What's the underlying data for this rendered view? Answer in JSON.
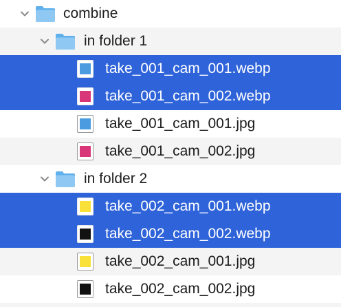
{
  "tree": {
    "root": {
      "name": "combine",
      "icon": "folder-icon",
      "expanded": true
    },
    "folders": [
      {
        "name": "in folder 1",
        "icon": "folder-icon",
        "expanded": true,
        "files": [
          {
            "name": "take_001_cam_001.webp",
            "swatch": "#4b9be0",
            "selected": true
          },
          {
            "name": "take_001_cam_002.webp",
            "swatch": "#d9367a",
            "selected": true
          },
          {
            "name": "take_001_cam_001.jpg",
            "swatch": "#4b9be0",
            "selected": false
          },
          {
            "name": "take_001_cam_002.jpg",
            "swatch": "#d9367a",
            "selected": false
          }
        ]
      },
      {
        "name": "in folder 2",
        "icon": "folder-icon",
        "expanded": true,
        "files": [
          {
            "name": "take_002_cam_001.webp",
            "swatch": "#f9e13a",
            "selected": true
          },
          {
            "name": "take_002_cam_002.webp",
            "swatch": "#121212",
            "selected": true
          },
          {
            "name": "take_002_cam_001.jpg",
            "swatch": "#f9e13a",
            "selected": false
          },
          {
            "name": "take_002_cam_002.jpg",
            "swatch": "#121212",
            "selected": false
          }
        ]
      }
    ]
  },
  "colors": {
    "selection": "#2f63d9",
    "zebra": "#f4f4f4",
    "folder_light": "#8fc9f3",
    "folder_dark": "#5fb0ec",
    "text": "#1c1c1c"
  }
}
